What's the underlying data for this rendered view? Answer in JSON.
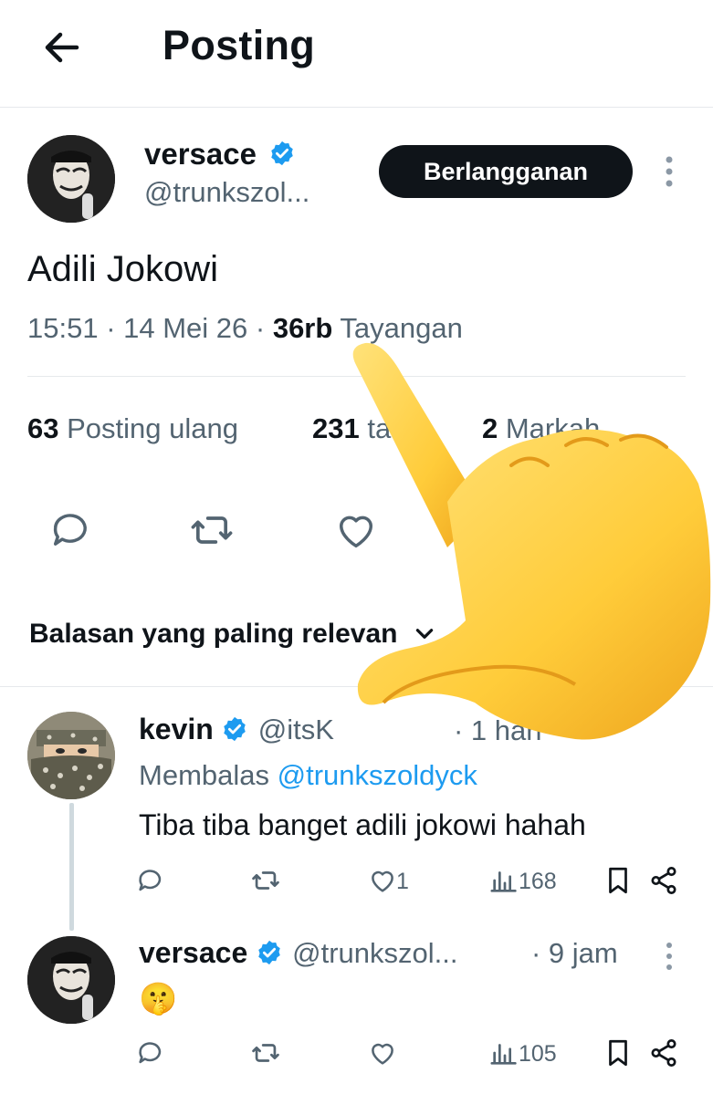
{
  "header": {
    "title": "Posting"
  },
  "tweet": {
    "author_name": "versace",
    "author_handle": "@trunkszol...",
    "subscribe_label": "Berlangganan",
    "text": "Adili Jokowi",
    "time": "15:51 · 14 Mei 26 · ",
    "views_count": "36rb",
    "views_label": " Tayangan",
    "reposts_count": "63",
    "reposts_label": " Posting ulang",
    "quotes_count": "231",
    "quotes_label": " ta",
    "bookmarks_count": "2",
    "bookmarks_label": " Markah"
  },
  "sort_label": "Balasan yang paling relevan",
  "replies": [
    {
      "name": "kevin",
      "handle": "@itsK",
      "time": "· 1 hari",
      "replying_prefix": "Membalas ",
      "replying_to": "@trunkszoldyck",
      "text": "Tiba tiba banget adili jokowi hahah",
      "likes": "1",
      "views": "168"
    },
    {
      "name": "versace",
      "handle": "@trunkszol...",
      "time": "· 9 jam",
      "text": "🤫",
      "likes": "",
      "views": "105"
    }
  ],
  "colors": {
    "accent": "#1d9bf0",
    "text": "#0f1419",
    "muted": "#536471",
    "verified": "#1d9bf0"
  },
  "icons": [
    "back-arrow-icon",
    "verified-icon",
    "more-vertical-icon",
    "reply-icon",
    "retweet-icon",
    "like-icon",
    "views-icon",
    "bookmark-icon",
    "share-icon",
    "chevron-down-icon",
    "pointing-hand-emoji"
  ]
}
